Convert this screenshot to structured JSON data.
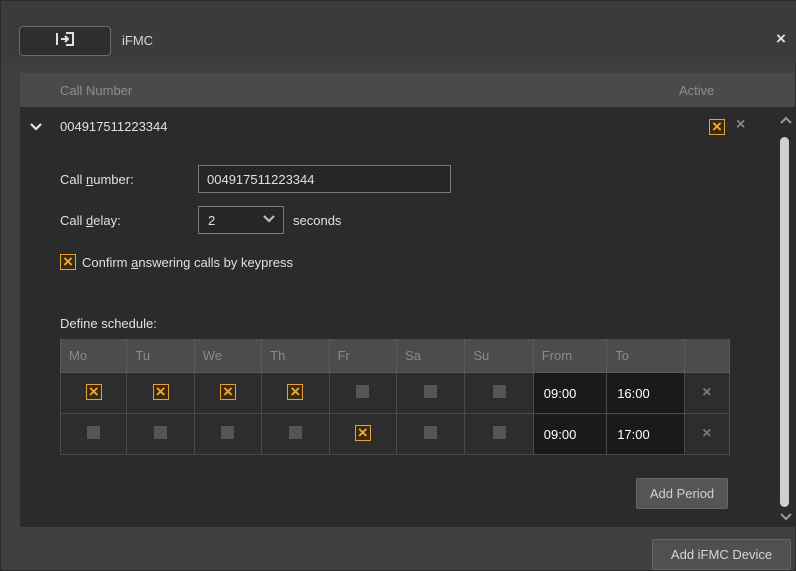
{
  "titlebar": {
    "device_icon": "device-transfer-icon",
    "title": "iFMC",
    "close_label": "×"
  },
  "list": {
    "col_call_number": "Call Number",
    "col_active": "Active"
  },
  "entry": {
    "number": "004917511223344",
    "active": true,
    "delete_label": "×",
    "call_number_label_pre": "Call ",
    "call_number_label_u": "n",
    "call_number_label_post": "umber:",
    "call_number_value": "004917511223344",
    "call_delay_label_pre": "Call ",
    "call_delay_label_u": "d",
    "call_delay_label_post": "elay:",
    "call_delay_value": "2",
    "seconds_label": "seconds",
    "confirm_checked": true,
    "confirm_label_pre": "Confirm ",
    "confirm_label_u": "a",
    "confirm_label_post": "nswering calls by keypress",
    "schedule_label": "Define schedule:",
    "schedule": {
      "headers": [
        "Mo",
        "Tu",
        "We",
        "Th",
        "Fr",
        "Sa",
        "Su",
        "From",
        "To",
        ""
      ],
      "rows": [
        {
          "days": [
            true,
            true,
            true,
            true,
            false,
            false,
            false
          ],
          "from": "09:00",
          "to": "16:00"
        },
        {
          "days": [
            false,
            false,
            false,
            false,
            true,
            false,
            false
          ],
          "from": "09:00",
          "to": "17:00"
        }
      ]
    },
    "add_period_label": "Add Period"
  },
  "footer": {
    "add_device_label": "Add iFMC Device"
  },
  "colors": {
    "accent": "#f0a830",
    "background": "#2b2b2b"
  }
}
